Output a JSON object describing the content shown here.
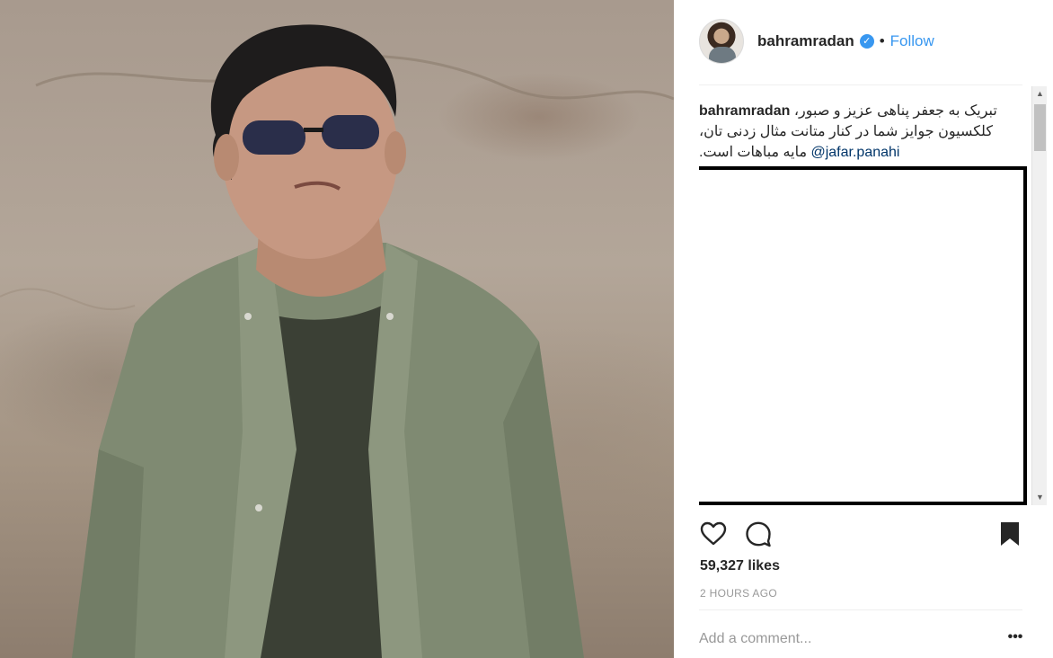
{
  "post": {
    "username": "bahramradan",
    "follow_label": "Follow",
    "dot": "•",
    "verified_glyph": "✓"
  },
  "caption": {
    "username": "bahramradan",
    "text": "تبریک به جعفر پناهی عزیز و صبور، کلکسیون جوایز شما در کنار متانت مثال زدنی تان، مایه مباهات است.",
    "mention": "@jafar.panahi"
  },
  "stats": {
    "likes": "59,327 likes",
    "time": "2 HOURS AGO"
  },
  "comment": {
    "placeholder": "Add a comment...",
    "more_label": "•••"
  },
  "icons": {
    "like": "heart-icon",
    "comment": "comment-bubble-icon",
    "save": "bookmark-icon",
    "more": "more-options-icon"
  },
  "colors": {
    "accent": "#3897f0",
    "mention": "#003569",
    "muted": "#999999"
  }
}
